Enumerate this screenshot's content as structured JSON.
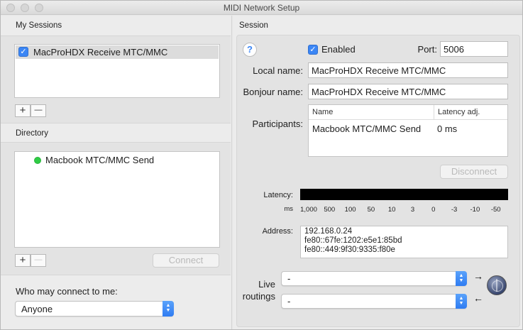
{
  "window": {
    "title": "MIDI Network Setup"
  },
  "my_sessions": {
    "heading": "My Sessions",
    "items": [
      {
        "label": "MacProHDX Receive MTC/MMC",
        "checked": true
      }
    ],
    "add_label": "+",
    "remove_label": "—"
  },
  "directory": {
    "heading": "Directory",
    "items": [
      {
        "label": "Macbook MTC/MMC Send",
        "status_color": "#2fcc45"
      }
    ],
    "add_label": "+",
    "remove_label": "—",
    "connect_label": "Connect"
  },
  "who_may_connect": {
    "label": "Who may connect to me:",
    "selected": "Anyone"
  },
  "session": {
    "heading": "Session",
    "help_label": "?",
    "enabled_label": "Enabled",
    "enabled": true,
    "port_label": "Port:",
    "port_value": "5006",
    "local_name_label": "Local name:",
    "local_name_value": "MacProHDX Receive MTC/MMC",
    "bonjour_name_label": "Bonjour name:",
    "bonjour_name_value": "MacProHDX Receive MTC/MMC",
    "participants_label": "Participants:",
    "participants_columns": {
      "name": "Name",
      "latency": "Latency adj."
    },
    "participants": [
      {
        "name": "Macbook MTC/MMC Send",
        "latency": "0 ms"
      }
    ],
    "disconnect_label": "Disconnect",
    "latency_label": "Latency:",
    "ms_label": "ms",
    "latency_scale": [
      "1,000",
      "500",
      "100",
      "50",
      "10",
      "3",
      "0",
      "-3",
      "-10",
      "-50"
    ],
    "address_label": "Address:",
    "addresses": [
      "192.168.0.24",
      "fe80::67fe:1202:e5e1:85bd",
      "fe80::449:9f30:9335:f80e"
    ],
    "live_routings_label_1": "Live",
    "live_routings_label_2": "routings",
    "routing_in_value": "-",
    "routing_out_value": "-",
    "arrow_out": "→",
    "arrow_in": "←"
  },
  "colors": {
    "accent": "#3b86f5",
    "online": "#2fcc45"
  }
}
